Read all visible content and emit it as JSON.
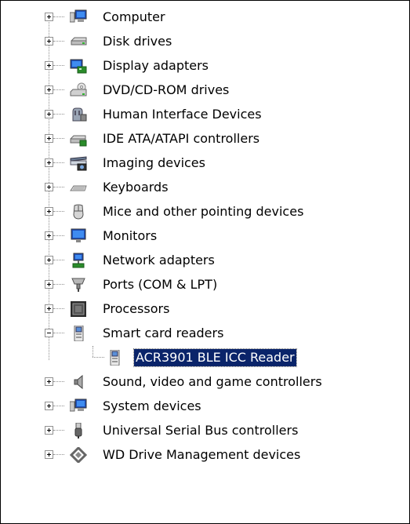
{
  "tree": {
    "items": [
      {
        "label": "Computer",
        "icon": "computer-icon",
        "state": "collapsed"
      },
      {
        "label": "Disk drives",
        "icon": "disk-drive-icon",
        "state": "collapsed"
      },
      {
        "label": "Display adapters",
        "icon": "display-adapter-icon",
        "state": "collapsed"
      },
      {
        "label": "DVD/CD-ROM drives",
        "icon": "dvd-drive-icon",
        "state": "collapsed"
      },
      {
        "label": "Human Interface Devices",
        "icon": "hid-icon",
        "state": "collapsed"
      },
      {
        "label": "IDE ATA/ATAPI controllers",
        "icon": "ide-controller-icon",
        "state": "collapsed"
      },
      {
        "label": "Imaging devices",
        "icon": "imaging-device-icon",
        "state": "collapsed"
      },
      {
        "label": "Keyboards",
        "icon": "keyboard-icon",
        "state": "collapsed"
      },
      {
        "label": "Mice and other pointing devices",
        "icon": "mouse-icon",
        "state": "collapsed"
      },
      {
        "label": "Monitors",
        "icon": "monitor-icon",
        "state": "collapsed"
      },
      {
        "label": "Network adapters",
        "icon": "network-adapter-icon",
        "state": "collapsed"
      },
      {
        "label": "Ports (COM & LPT)",
        "icon": "port-icon",
        "state": "collapsed"
      },
      {
        "label": "Processors",
        "icon": "processor-icon",
        "state": "collapsed"
      },
      {
        "label": "Smart card readers",
        "icon": "smart-card-reader-icon",
        "state": "expanded",
        "children": [
          {
            "label": "ACR3901 BLE ICC Reader",
            "icon": "smart-card-reader-icon",
            "selected": true
          }
        ]
      },
      {
        "label": "Sound, video and game controllers",
        "icon": "speaker-icon",
        "state": "collapsed"
      },
      {
        "label": "System devices",
        "icon": "system-device-icon",
        "state": "collapsed"
      },
      {
        "label": "Universal Serial Bus controllers",
        "icon": "usb-icon",
        "state": "collapsed"
      },
      {
        "label": "WD Drive Management devices",
        "icon": "wd-diamond-icon",
        "state": "collapsed"
      }
    ]
  },
  "colors": {
    "selection": "#0a246a",
    "selection_text": "#ffffff"
  }
}
